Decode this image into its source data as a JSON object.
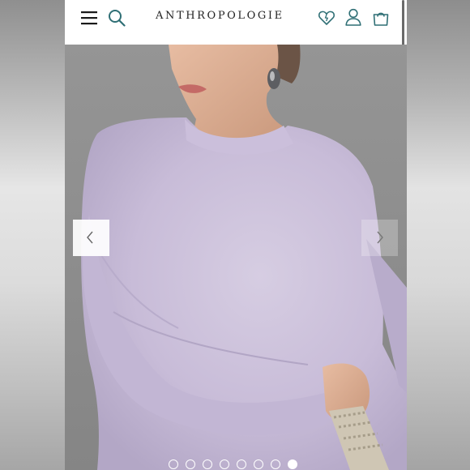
{
  "header": {
    "brand": "ANTHROPOLOGIE",
    "icons": [
      "menu-icon",
      "search-icon",
      "heart-icon",
      "user-icon",
      "bag-icon"
    ],
    "accent_color": "#2f6f75"
  },
  "gallery": {
    "product_colors": {
      "top": "#c8bcd8",
      "background": "#8e8e8e"
    },
    "prev_icon": "chevron-left-icon",
    "next_icon": "chevron-right-icon",
    "slide_count": 8,
    "active_index": 7
  }
}
